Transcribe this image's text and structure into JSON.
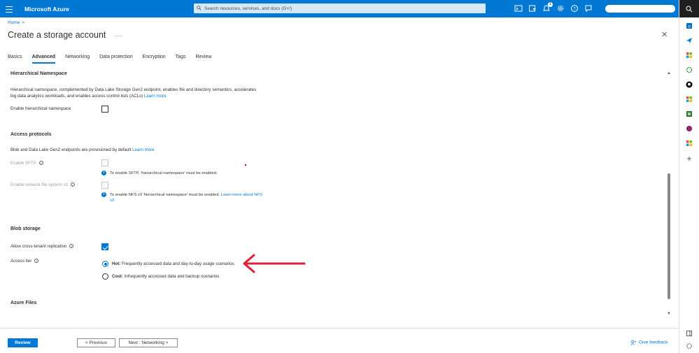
{
  "topbar": {
    "brand": "Microsoft Azure",
    "search_placeholder": "Search resources, services, and docs (G+/)",
    "notification_count": "1"
  },
  "breadcrumb": {
    "home": "Home",
    "separator": ">"
  },
  "page": {
    "title": "Create a storage account",
    "more": "...",
    "close": "✕"
  },
  "tabs": [
    {
      "label": "Basics"
    },
    {
      "label": "Advanced",
      "active": true
    },
    {
      "label": "Networking"
    },
    {
      "label": "Data protection"
    },
    {
      "label": "Encryption"
    },
    {
      "label": "Tags"
    },
    {
      "label": "Review"
    }
  ],
  "hierarchical": {
    "heading": "Hierarchical Namespace",
    "desc_line1": "Hierarchical namespace, complemented by Data Lake Storage Gen2 endpoint, enables file and directory semantics, accelerates",
    "desc_line2": "big data analytics workloads, and enables access control lists (ACLs)",
    "learn_more": "Learn more",
    "enable_label": "Enable hierarchical namespace"
  },
  "access": {
    "heading": "Access protocols",
    "desc": "Blob and Data Lake Gen2 endpoints are provisioned by default",
    "learn_more": "Learn more",
    "sftp_label": "Enable SFTP",
    "sftp_note": "To enable SFTP, 'hierarchical namespace' must be enabled.",
    "nfs_label": "Enable network file system v3",
    "nfs_note": "To enable NFS v3 'hierarchical namespace' must be enabled.",
    "nfs_link_1": "Learn more about NFS",
    "nfs_link_2": "v3",
    "info_glyph": "i"
  },
  "blob": {
    "heading": "Blob storage",
    "cross_tenant_label": "Allow cross-tenant replication",
    "cross_tenant_checked": true,
    "access_tier_label": "Access tier",
    "hot_bold": "Hot:",
    "hot_text": " Frequently accessed data and day-to-day usage scenarios",
    "cool_bold": "Cool:",
    "cool_text": " Infrequently accessed data and backup scenarios",
    "selected_tier": "Hot"
  },
  "azure_files": {
    "heading": "Azure Files"
  },
  "footer": {
    "review": "Review",
    "previous": "< Previous",
    "next": "Next : Networking >",
    "feedback": "Give feedback"
  },
  "colors": {
    "accent": "#0078d4",
    "annotation_arrow": "#e01e37"
  }
}
